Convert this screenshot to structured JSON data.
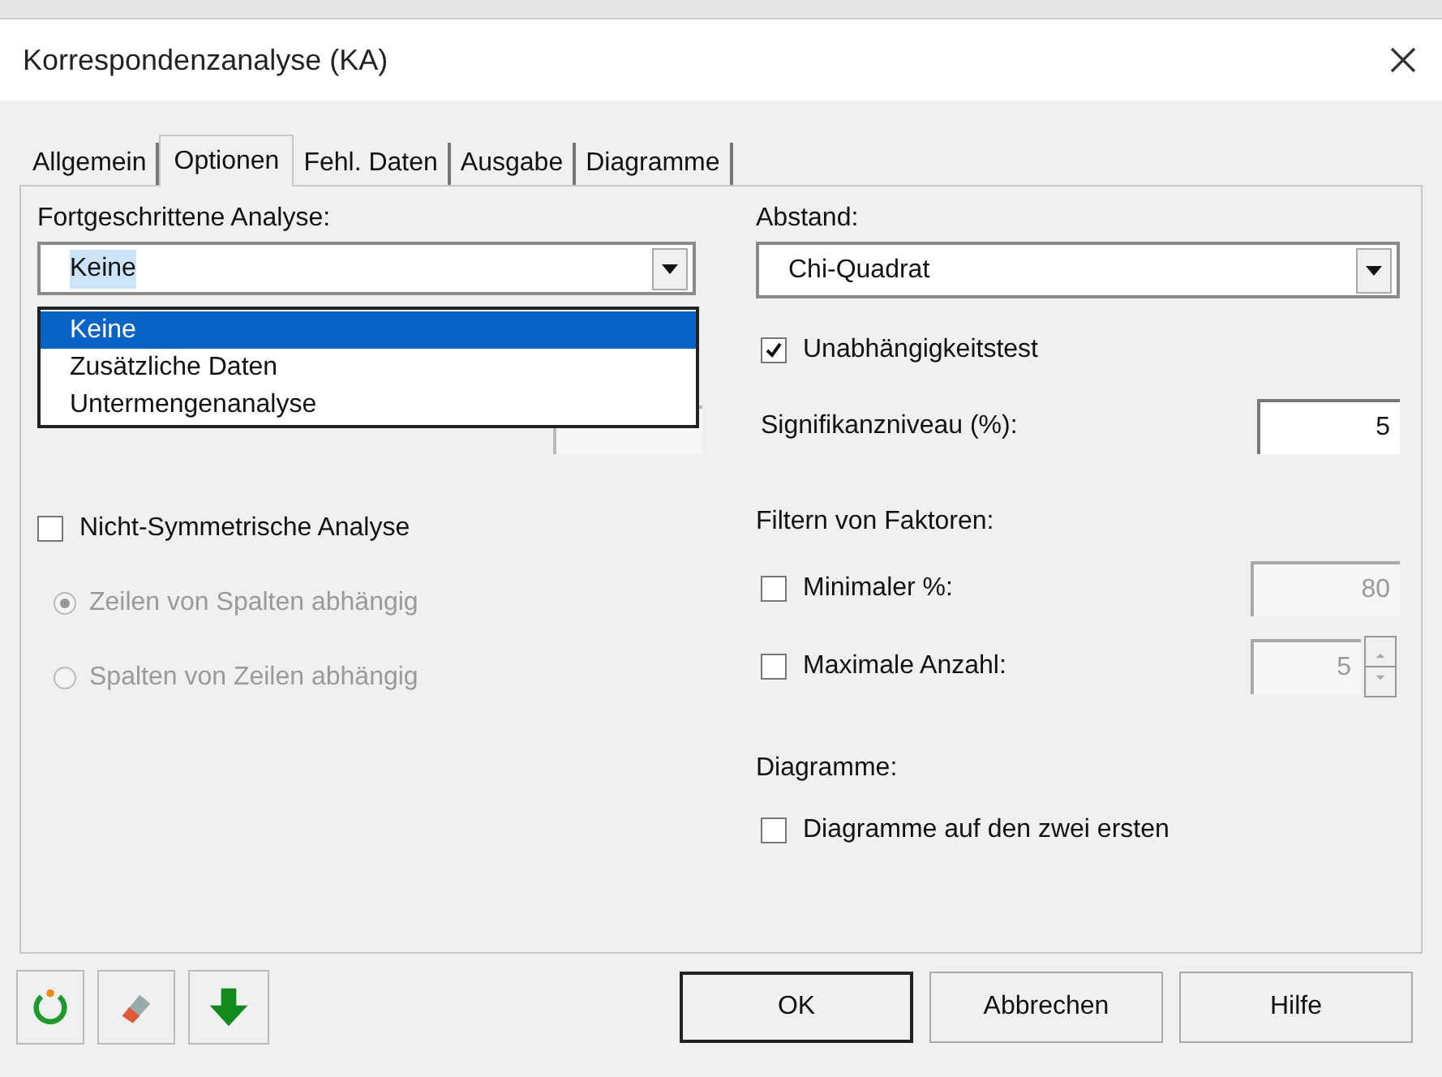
{
  "window": {
    "title": "Korrespondenzanalyse (KA)"
  },
  "tabs": [
    {
      "label": "Allgemein",
      "selected": false
    },
    {
      "label": "Optionen",
      "selected": true
    },
    {
      "label": "Fehl. Daten",
      "selected": false
    },
    {
      "label": "Ausgabe",
      "selected": false
    },
    {
      "label": "Diagramme",
      "selected": false
    }
  ],
  "advanced_analysis": {
    "label": "Fortgeschrittene Analyse:",
    "value": "Keine",
    "value_highlighted": true,
    "expanded": true,
    "options": [
      {
        "label": "Keine",
        "selected": true
      },
      {
        "label": "Zusätzliche Daten",
        "selected": false
      },
      {
        "label": "Untermengenanalyse",
        "selected": false
      }
    ]
  },
  "non_symmetric": {
    "label": "Nicht-Symmetrische Analyse",
    "checked": false
  },
  "radios": [
    {
      "label": "Zeilen von Spalten abhängig",
      "selected": true,
      "disabled": true
    },
    {
      "label": "Spalten von Zeilen abhängig",
      "selected": false,
      "disabled": true
    }
  ],
  "distance": {
    "label": "Abstand:",
    "value": "Chi-Quadrat"
  },
  "independence_test": {
    "label": "Unabhängigkeitstest",
    "checked": true
  },
  "significance": {
    "label": "Signifikanzniveau (%):",
    "value": "5"
  },
  "filter": {
    "label": "Filtern von Faktoren:",
    "items": [
      {
        "kind": "field",
        "label": "Minimaler %:",
        "checked": false,
        "value": "80",
        "disabled": true
      },
      {
        "kind": "spinner",
        "label": "Maximale Anzahl:",
        "checked": false,
        "value": "5",
        "disabled": true
      }
    ]
  },
  "charts": {
    "label": "Diagramme:",
    "option": {
      "label": "Diagramme auf den zwei ersten",
      "checked": false
    }
  },
  "buttons": [
    {
      "label": "OK",
      "default": true
    },
    {
      "label": "Abbrechen",
      "default": false
    },
    {
      "label": "Hilfe",
      "default": false
    }
  ]
}
